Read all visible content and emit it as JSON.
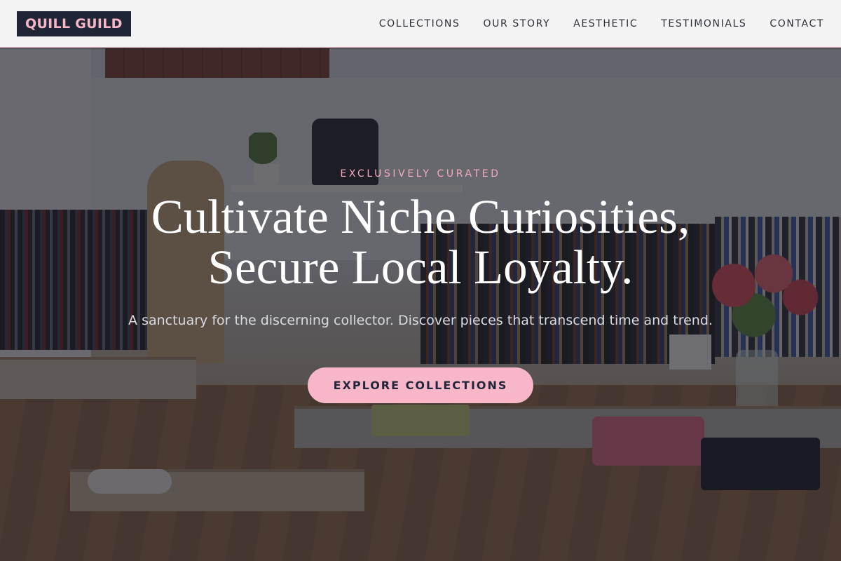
{
  "header": {
    "logo": "QUILL GUILD",
    "nav": [
      {
        "label": "COLLECTIONS"
      },
      {
        "label": "OUR STORY"
      },
      {
        "label": "AESTHETIC"
      },
      {
        "label": "TESTIMONIALS"
      },
      {
        "label": "CONTACT"
      }
    ]
  },
  "hero": {
    "eyebrow": "EXCLUSIVELY CURATED",
    "headline_line1": "Cultivate Niche Curiosities,",
    "headline_line2": "Secure Local Loyalty.",
    "subtitle": "A sanctuary for the discerning collector. Discover pieces that transcend time and trend.",
    "cta_label": "EXPLORE COLLECTIONS"
  },
  "colors": {
    "logo_bg": "#1f2535",
    "logo_text": "#f6b6c8",
    "accent_pink": "#f8b7c8",
    "eyebrow": "#f4a9bd",
    "header_bg": "#f4f3f3",
    "nav_text": "#2b2f3a"
  }
}
